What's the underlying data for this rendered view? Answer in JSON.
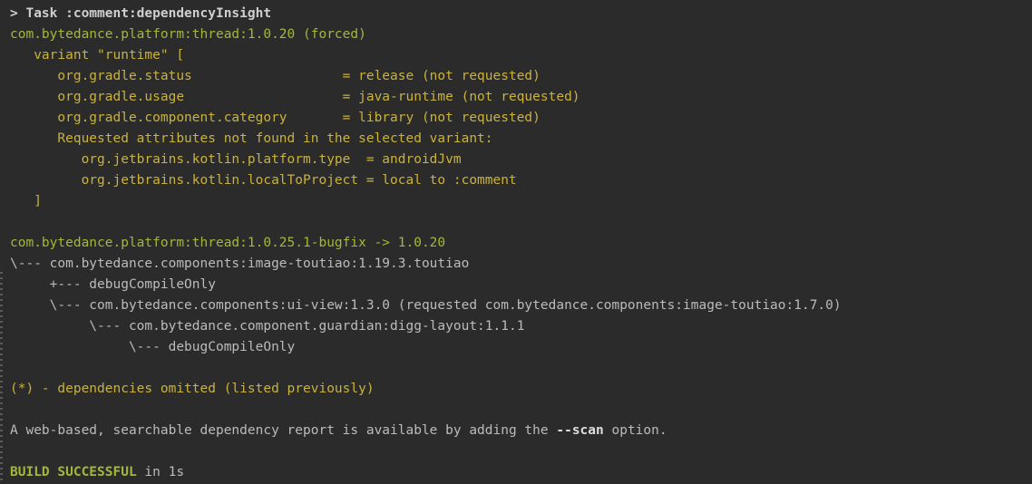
{
  "console": {
    "lines": [
      {
        "text": "> Task :comment:dependencyInsight",
        "style": "task"
      },
      {
        "text": "com.bytedance.platform:thread:1.0.20 (forced)",
        "style": "green"
      },
      {
        "text": "   variant \"runtime\" [",
        "style": "yellow"
      },
      {
        "text": "      org.gradle.status                   = release (not requested)",
        "style": "yellow"
      },
      {
        "text": "      org.gradle.usage                    = java-runtime (not requested)",
        "style": "yellow"
      },
      {
        "text": "      org.gradle.component.category       = library (not requested)",
        "style": "yellow"
      },
      {
        "text": "      Requested attributes not found in the selected variant:",
        "style": "yellow"
      },
      {
        "text": "         org.jetbrains.kotlin.platform.type  = androidJvm",
        "style": "yellow"
      },
      {
        "text": "         org.jetbrains.kotlin.localToProject = local to :comment",
        "style": "yellow"
      },
      {
        "text": "   ]",
        "style": "yellow"
      },
      {
        "text": "",
        "style": "gray"
      },
      {
        "text": "com.bytedance.platform:thread:1.0.25.1-bugfix -> 1.0.20",
        "style": "green"
      },
      {
        "text": "\\--- com.bytedance.components:image-toutiao:1.19.3.toutiao",
        "style": "gray"
      },
      {
        "text": "     +--- debugCompileOnly",
        "style": "gray"
      },
      {
        "text": "     \\--- com.bytedance.components:ui-view:1.3.0 (requested com.bytedance.components:image-toutiao:1.7.0)",
        "style": "gray"
      },
      {
        "text": "          \\--- com.bytedance.component.guardian:digg-layout:1.1.1",
        "style": "gray"
      },
      {
        "text": "               \\--- debugCompileOnly",
        "style": "gray"
      },
      {
        "text": "",
        "style": "gray"
      },
      {
        "text": "(*) - dependencies omitted (listed previously)",
        "style": "yellow"
      },
      {
        "text": "",
        "style": "gray"
      }
    ],
    "scan_prefix": "A web-based, searchable dependency report is available by adding the ",
    "scan_flag": "--scan",
    "scan_suffix": " option.",
    "build_status": "BUILD SUCCESSFUL",
    "build_time": " in 1s"
  },
  "colors": {
    "background": "#2b2b2b",
    "green": "#a3b83a",
    "yellow": "#c9b23d",
    "gray": "#bbbbbb"
  }
}
